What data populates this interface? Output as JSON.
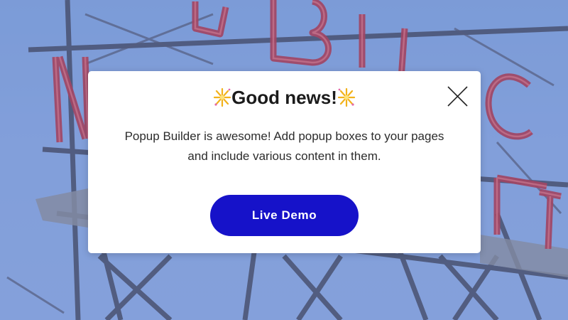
{
  "background": {
    "image": "public-market-sign-photo",
    "tint": "#8aa6dc"
  },
  "popup": {
    "title": "Good news!",
    "title_icon": "sparkle-icon",
    "body_line_1": "Popup Builder is awesome! Add popup boxes to your pages",
    "body_line_2": "and include various content in them.",
    "cta_label": "Live Demo",
    "close_icon": "close-icon",
    "cta_color": "#1612c9"
  }
}
